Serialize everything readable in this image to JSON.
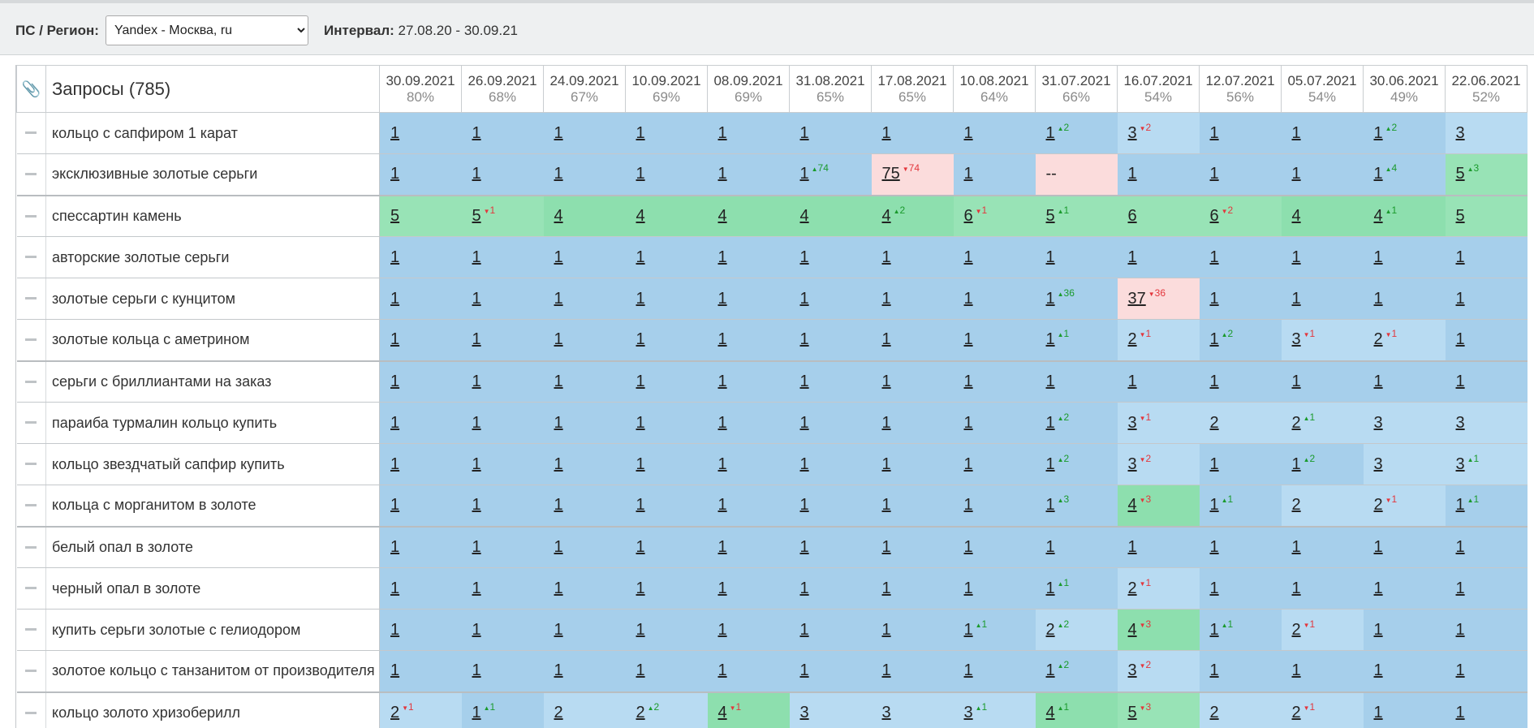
{
  "toolbar": {
    "ps_label": "ПС / Регион:",
    "region_selected": "Yandex - Москва, ru",
    "interval_label": "Интервал:",
    "interval_value": "27.08.20 - 30.09.21"
  },
  "table": {
    "header_icon": "paperclip-icon",
    "queries_header": "Запросы (785)",
    "dates": [
      {
        "date": "30.09.2021",
        "pct": "80%"
      },
      {
        "date": "26.09.2021",
        "pct": "68%"
      },
      {
        "date": "24.09.2021",
        "pct": "67%"
      },
      {
        "date": "10.09.2021",
        "pct": "69%"
      },
      {
        "date": "08.09.2021",
        "pct": "69%"
      },
      {
        "date": "31.08.2021",
        "pct": "65%"
      },
      {
        "date": "17.08.2021",
        "pct": "65%"
      },
      {
        "date": "10.08.2021",
        "pct": "64%"
      },
      {
        "date": "31.07.2021",
        "pct": "66%"
      },
      {
        "date": "16.07.2021",
        "pct": "54%"
      },
      {
        "date": "12.07.2021",
        "pct": "56%"
      },
      {
        "date": "05.07.2021",
        "pct": "54%"
      },
      {
        "date": "30.06.2021",
        "pct": "49%"
      },
      {
        "date": "22.06.2021",
        "pct": "52%"
      }
    ],
    "rows": [
      {
        "query": "кольцо с сапфиром 1 карат",
        "group": false,
        "cells": [
          {
            "v": "1"
          },
          {
            "v": "1"
          },
          {
            "v": "1"
          },
          {
            "v": "1"
          },
          {
            "v": "1"
          },
          {
            "v": "1"
          },
          {
            "v": "1"
          },
          {
            "v": "1"
          },
          {
            "v": "1",
            "dir": "up",
            "d": "2"
          },
          {
            "v": "3",
            "dir": "dn",
            "d": "2",
            "bg": "lb"
          },
          {
            "v": "1"
          },
          {
            "v": "1"
          },
          {
            "v": "1",
            "dir": "up",
            "d": "2"
          },
          {
            "v": "3",
            "bg": "lb"
          }
        ]
      },
      {
        "query": "эксклюзивные золотые серьги",
        "group": true,
        "cells": [
          {
            "v": "1"
          },
          {
            "v": "1"
          },
          {
            "v": "1"
          },
          {
            "v": "1"
          },
          {
            "v": "1"
          },
          {
            "v": "1",
            "dir": "up",
            "d": "74"
          },
          {
            "v": "75",
            "dir": "dn",
            "d": "74",
            "bg": "r"
          },
          {
            "v": "1"
          },
          {
            "v": "--",
            "bg": "r",
            "plain": true
          },
          {
            "v": "1"
          },
          {
            "v": "1"
          },
          {
            "v": "1"
          },
          {
            "v": "1",
            "dir": "up",
            "d": "4"
          },
          {
            "v": "5",
            "dir": "up",
            "d": "3",
            "bg": "g"
          }
        ]
      },
      {
        "query": "спессартин камень",
        "group": false,
        "cells": [
          {
            "v": "5",
            "bg": "g"
          },
          {
            "v": "5",
            "dir": "dn",
            "d": "1",
            "bg": "g"
          },
          {
            "v": "4",
            "bg": "dg"
          },
          {
            "v": "4",
            "bg": "dg"
          },
          {
            "v": "4",
            "bg": "dg"
          },
          {
            "v": "4",
            "bg": "dg"
          },
          {
            "v": "4",
            "dir": "up",
            "d": "2",
            "bg": "dg"
          },
          {
            "v": "6",
            "dir": "dn",
            "d": "1",
            "bg": "g"
          },
          {
            "v": "5",
            "dir": "up",
            "d": "1",
            "bg": "g"
          },
          {
            "v": "6",
            "bg": "g"
          },
          {
            "v": "6",
            "dir": "dn",
            "d": "2",
            "bg": "g"
          },
          {
            "v": "4",
            "bg": "dg"
          },
          {
            "v": "4",
            "dir": "up",
            "d": "1",
            "bg": "dg"
          },
          {
            "v": "5",
            "bg": "g"
          }
        ]
      },
      {
        "query": "авторские золотые серьги",
        "group": false,
        "cells": [
          {
            "v": "1"
          },
          {
            "v": "1"
          },
          {
            "v": "1"
          },
          {
            "v": "1"
          },
          {
            "v": "1"
          },
          {
            "v": "1"
          },
          {
            "v": "1"
          },
          {
            "v": "1"
          },
          {
            "v": "1"
          },
          {
            "v": "1"
          },
          {
            "v": "1"
          },
          {
            "v": "1"
          },
          {
            "v": "1"
          },
          {
            "v": "1"
          }
        ]
      },
      {
        "query": "золотые серьги с кунцитом",
        "group": false,
        "cells": [
          {
            "v": "1"
          },
          {
            "v": "1"
          },
          {
            "v": "1"
          },
          {
            "v": "1"
          },
          {
            "v": "1"
          },
          {
            "v": "1"
          },
          {
            "v": "1"
          },
          {
            "v": "1"
          },
          {
            "v": "1",
            "dir": "up",
            "d": "36"
          },
          {
            "v": "37",
            "dir": "dn",
            "d": "36",
            "bg": "r"
          },
          {
            "v": "1"
          },
          {
            "v": "1"
          },
          {
            "v": "1"
          },
          {
            "v": "1"
          }
        ]
      },
      {
        "query": "золотые кольца с аметрином",
        "group": true,
        "cells": [
          {
            "v": "1"
          },
          {
            "v": "1"
          },
          {
            "v": "1"
          },
          {
            "v": "1"
          },
          {
            "v": "1"
          },
          {
            "v": "1"
          },
          {
            "v": "1"
          },
          {
            "v": "1"
          },
          {
            "v": "1",
            "dir": "up",
            "d": "1"
          },
          {
            "v": "2",
            "dir": "dn",
            "d": "1",
            "bg": "lb"
          },
          {
            "v": "1",
            "dir": "up",
            "d": "2"
          },
          {
            "v": "3",
            "dir": "dn",
            "d": "1",
            "bg": "lb"
          },
          {
            "v": "2",
            "dir": "dn",
            "d": "1",
            "bg": "lb"
          },
          {
            "v": "1"
          }
        ]
      },
      {
        "query": "серьги с бриллиантами на заказ",
        "group": false,
        "cells": [
          {
            "v": "1"
          },
          {
            "v": "1"
          },
          {
            "v": "1"
          },
          {
            "v": "1"
          },
          {
            "v": "1"
          },
          {
            "v": "1"
          },
          {
            "v": "1"
          },
          {
            "v": "1"
          },
          {
            "v": "1"
          },
          {
            "v": "1"
          },
          {
            "v": "1"
          },
          {
            "v": "1"
          },
          {
            "v": "1"
          },
          {
            "v": "1"
          }
        ]
      },
      {
        "query": "параиба турмалин кольцо купить",
        "group": false,
        "cells": [
          {
            "v": "1"
          },
          {
            "v": "1"
          },
          {
            "v": "1"
          },
          {
            "v": "1"
          },
          {
            "v": "1"
          },
          {
            "v": "1"
          },
          {
            "v": "1"
          },
          {
            "v": "1"
          },
          {
            "v": "1",
            "dir": "up",
            "d": "2"
          },
          {
            "v": "3",
            "dir": "dn",
            "d": "1",
            "bg": "lb"
          },
          {
            "v": "2",
            "bg": "lb"
          },
          {
            "v": "2",
            "dir": "up",
            "d": "1",
            "bg": "lb"
          },
          {
            "v": "3",
            "bg": "lb"
          },
          {
            "v": "3",
            "bg": "lb"
          }
        ]
      },
      {
        "query": "кольцо звездчатый сапфир купить",
        "group": false,
        "cells": [
          {
            "v": "1"
          },
          {
            "v": "1"
          },
          {
            "v": "1"
          },
          {
            "v": "1"
          },
          {
            "v": "1"
          },
          {
            "v": "1"
          },
          {
            "v": "1"
          },
          {
            "v": "1"
          },
          {
            "v": "1",
            "dir": "up",
            "d": "2"
          },
          {
            "v": "3",
            "dir": "dn",
            "d": "2",
            "bg": "lb"
          },
          {
            "v": "1"
          },
          {
            "v": "1",
            "dir": "up",
            "d": "2"
          },
          {
            "v": "3",
            "bg": "lb"
          },
          {
            "v": "3",
            "dir": "up",
            "d": "1",
            "bg": "lb"
          }
        ]
      },
      {
        "query": "кольца с морганитом в золоте",
        "group": true,
        "cells": [
          {
            "v": "1"
          },
          {
            "v": "1"
          },
          {
            "v": "1"
          },
          {
            "v": "1"
          },
          {
            "v": "1"
          },
          {
            "v": "1"
          },
          {
            "v": "1"
          },
          {
            "v": "1"
          },
          {
            "v": "1",
            "dir": "up",
            "d": "3"
          },
          {
            "v": "4",
            "dir": "dn",
            "d": "3",
            "bg": "dg"
          },
          {
            "v": "1",
            "dir": "up",
            "d": "1"
          },
          {
            "v": "2",
            "bg": "lb"
          },
          {
            "v": "2",
            "dir": "dn",
            "d": "1",
            "bg": "lb"
          },
          {
            "v": "1",
            "dir": "up",
            "d": "1"
          }
        ]
      },
      {
        "query": "белый опал в золоте",
        "group": false,
        "cells": [
          {
            "v": "1"
          },
          {
            "v": "1"
          },
          {
            "v": "1"
          },
          {
            "v": "1"
          },
          {
            "v": "1"
          },
          {
            "v": "1"
          },
          {
            "v": "1"
          },
          {
            "v": "1"
          },
          {
            "v": "1"
          },
          {
            "v": "1"
          },
          {
            "v": "1"
          },
          {
            "v": "1"
          },
          {
            "v": "1"
          },
          {
            "v": "1"
          }
        ]
      },
      {
        "query": "черный опал в золоте",
        "group": false,
        "cells": [
          {
            "v": "1"
          },
          {
            "v": "1"
          },
          {
            "v": "1"
          },
          {
            "v": "1"
          },
          {
            "v": "1"
          },
          {
            "v": "1"
          },
          {
            "v": "1"
          },
          {
            "v": "1"
          },
          {
            "v": "1",
            "dir": "up",
            "d": "1"
          },
          {
            "v": "2",
            "dir": "dn",
            "d": "1",
            "bg": "lb"
          },
          {
            "v": "1"
          },
          {
            "v": "1"
          },
          {
            "v": "1"
          },
          {
            "v": "1"
          }
        ]
      },
      {
        "query": "купить серьги золотые с гелиодором",
        "group": false,
        "cells": [
          {
            "v": "1"
          },
          {
            "v": "1"
          },
          {
            "v": "1"
          },
          {
            "v": "1"
          },
          {
            "v": "1"
          },
          {
            "v": "1"
          },
          {
            "v": "1"
          },
          {
            "v": "1",
            "dir": "up",
            "d": "1"
          },
          {
            "v": "2",
            "dir": "up",
            "d": "2",
            "bg": "lb"
          },
          {
            "v": "4",
            "dir": "dn",
            "d": "3",
            "bg": "dg"
          },
          {
            "v": "1",
            "dir": "up",
            "d": "1"
          },
          {
            "v": "2",
            "dir": "dn",
            "d": "1",
            "bg": "lb"
          },
          {
            "v": "1"
          },
          {
            "v": "1"
          }
        ]
      },
      {
        "query": "золотое кольцо с танзанитом от производителя",
        "group": true,
        "cells": [
          {
            "v": "1"
          },
          {
            "v": "1"
          },
          {
            "v": "1"
          },
          {
            "v": "1"
          },
          {
            "v": "1"
          },
          {
            "v": "1"
          },
          {
            "v": "1"
          },
          {
            "v": "1"
          },
          {
            "v": "1",
            "dir": "up",
            "d": "2"
          },
          {
            "v": "3",
            "dir": "dn",
            "d": "2",
            "bg": "lb"
          },
          {
            "v": "1"
          },
          {
            "v": "1"
          },
          {
            "v": "1"
          },
          {
            "v": "1"
          }
        ]
      },
      {
        "query": "кольцо золото хризоберилл",
        "group": false,
        "cells": [
          {
            "v": "2",
            "dir": "dn",
            "d": "1",
            "bg": "lb"
          },
          {
            "v": "1",
            "dir": "up",
            "d": "1"
          },
          {
            "v": "2",
            "bg": "lb"
          },
          {
            "v": "2",
            "dir": "up",
            "d": "2",
            "bg": "lb"
          },
          {
            "v": "4",
            "dir": "dn",
            "d": "1",
            "bg": "dg"
          },
          {
            "v": "3",
            "bg": "lb"
          },
          {
            "v": "3",
            "bg": "lb"
          },
          {
            "v": "3",
            "dir": "up",
            "d": "1",
            "bg": "lb"
          },
          {
            "v": "4",
            "dir": "up",
            "d": "1",
            "bg": "dg"
          },
          {
            "v": "5",
            "dir": "dn",
            "d": "3",
            "bg": "g"
          },
          {
            "v": "2",
            "bg": "lb"
          },
          {
            "v": "2",
            "dir": "dn",
            "d": "1",
            "bg": "lb"
          },
          {
            "v": "1"
          },
          {
            "v": "1"
          }
        ]
      }
    ]
  }
}
